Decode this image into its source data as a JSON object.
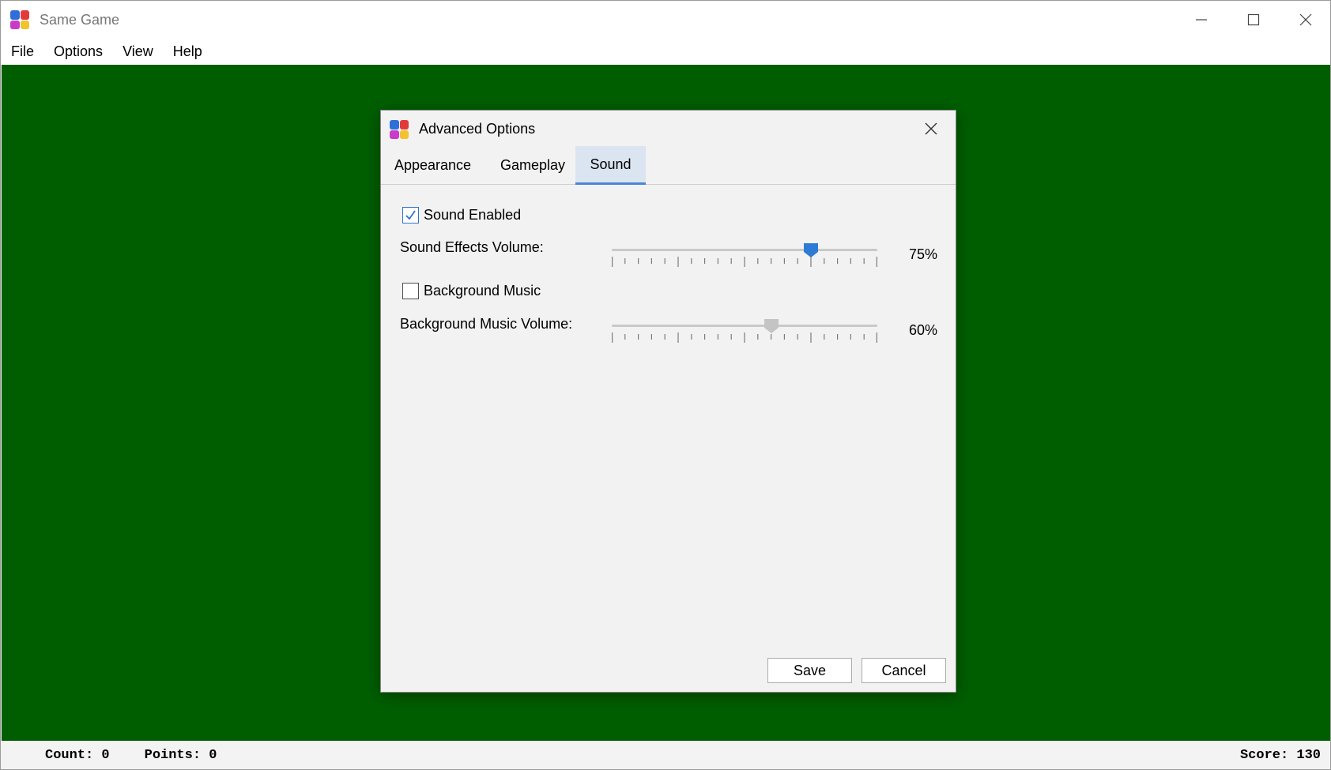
{
  "window": {
    "title": "Same Game",
    "icon": "same-game-app-icon",
    "controls": [
      "minimize-icon",
      "maximize-icon",
      "close-icon"
    ]
  },
  "menu": [
    {
      "id": "file",
      "label": "File"
    },
    {
      "id": "options",
      "label": "Options"
    },
    {
      "id": "view",
      "label": "View"
    },
    {
      "id": "help",
      "label": "Help"
    }
  ],
  "colors": {
    "board": "#005e00",
    "accent": "#2e7bd6",
    "tab_active_bg": "#dbe5f1",
    "dialog_bg": "#f2f2f2",
    "icon_tiles": [
      "#2f6fd8",
      "#e23a3a",
      "#c93cc9",
      "#f2c230"
    ]
  },
  "dialog": {
    "title": "Advanced Options",
    "tabs": [
      {
        "id": "appearance",
        "label": "Appearance",
        "active": false
      },
      {
        "id": "gameplay",
        "label": "Gameplay",
        "active": false
      },
      {
        "id": "sound",
        "label": "Sound",
        "active": true
      }
    ],
    "sound": {
      "sound_enabled": {
        "label": "Sound Enabled",
        "checked": true
      },
      "effects_volume": {
        "label": "Sound Effects Volume:",
        "value": 75,
        "display": "75%",
        "min": 0,
        "max": 100,
        "enabled": true
      },
      "background_music": {
        "label": "Background Music",
        "checked": false
      },
      "music_volume": {
        "label": "Background Music Volume:",
        "value": 60,
        "display": "60%",
        "min": 0,
        "max": 100,
        "enabled": false
      }
    },
    "buttons": {
      "save": "Save",
      "cancel": "Cancel"
    }
  },
  "status": {
    "count": "Count: 0",
    "points": "Points: 0",
    "score": "Score: 130"
  }
}
